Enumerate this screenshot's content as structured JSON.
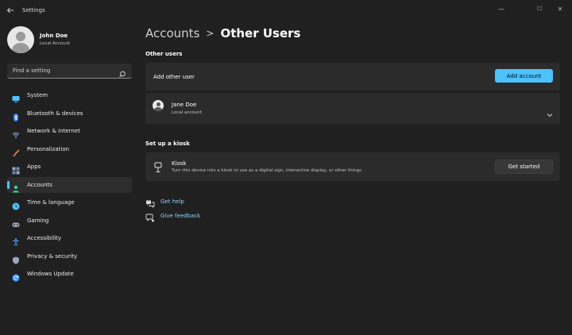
{
  "window": {
    "title": "Settings",
    "controls": {
      "minimize": "—",
      "maximize": "☐",
      "close": "✕"
    }
  },
  "profile": {
    "name": "John Doe",
    "account_type": "Local Account"
  },
  "search": {
    "placeholder": "Find a setting"
  },
  "sidebar": {
    "items": [
      {
        "label": "System",
        "icon": "monitor-icon",
        "color": "#4cc2ff"
      },
      {
        "label": "Bluetooth & devices",
        "icon": "bluetooth-icon",
        "color": "#4c9bff"
      },
      {
        "label": "Network & internet",
        "icon": "wifi-icon",
        "color": "#8ab4f8"
      },
      {
        "label": "Personalization",
        "icon": "brush-icon",
        "color": "#f0a050"
      },
      {
        "label": "Apps",
        "icon": "apps-icon",
        "color": "#9aa7b8"
      },
      {
        "label": "Accounts",
        "icon": "account-icon",
        "color": "#3fd0a0",
        "active": true
      },
      {
        "label": "Time & language",
        "icon": "globe-clock-icon",
        "color": "#4cc2ff"
      },
      {
        "label": "Gaming",
        "icon": "gamepad-icon",
        "color": "#9aa7b8"
      },
      {
        "label": "Accessibility",
        "icon": "accessibility-icon",
        "color": "#4c9bff"
      },
      {
        "label": "Privacy & security",
        "icon": "shield-icon",
        "color": "#9aa7b8"
      },
      {
        "label": "Windows Update",
        "icon": "update-icon",
        "color": "#2f8fff"
      }
    ]
  },
  "breadcrumb": {
    "parent": "Accounts",
    "separator": ">",
    "current": "Other Users"
  },
  "other_users": {
    "section_title": "Other users",
    "add_label": "Add other user",
    "add_button": "Add account",
    "user": {
      "name": "Jane Doe",
      "type": "Local account"
    }
  },
  "kiosk": {
    "section_title": "Set up a kiosk",
    "title": "Kiosk",
    "description": "Turn this device into a kiosk to use as a digital sign, interactive display, or other things",
    "button": "Get started"
  },
  "links": {
    "help": "Get help",
    "feedback": "Give feedback"
  },
  "colors": {
    "accent": "#4cc2ff",
    "background": "#202020",
    "card": "#2b2b2b"
  }
}
